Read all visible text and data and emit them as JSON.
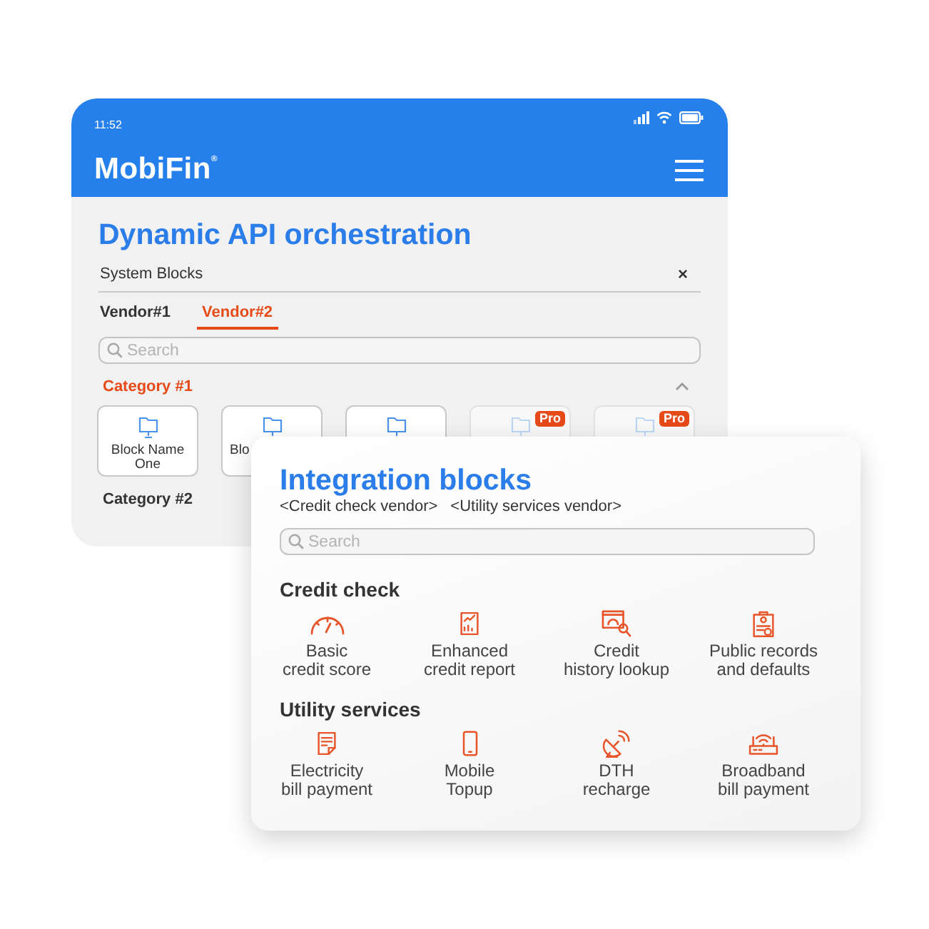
{
  "status_bar": {
    "time": "11:52"
  },
  "app_bar": {
    "logo": "MobiFin$^{®}$"
  },
  "screen": {
    "title": "Dynamic API orchestration",
    "panel": {
      "label": "System Blocks",
      "close": "×"
    },
    "tabs": [
      {
        "label": "Vendor#1",
        "selected": false
      },
      {
        "label": "Vendor#2",
        "selected": true
      }
    ],
    "search": {
      "placeholder": "Search"
    },
    "categories": [
      {
        "title": "Category #1",
        "expanded": true,
        "blocks": [
          {
            "label": "Block Name One",
            "disabled": false
          },
          {
            "label": "Blo",
            "disabled": false
          },
          {
            "disabled": false
          },
          {
            "badge": "Pro",
            "disabled": true
          },
          {
            "badge": "Pro",
            "disabled": true
          }
        ]
      },
      {
        "title": "Category #2",
        "expanded": false
      }
    ]
  },
  "integration_card": {
    "title": "Integration blocks",
    "vendors": [
      "<Credit check vendor>",
      "<Utility services vendor>"
    ],
    "search": {
      "placeholder": "Search"
    },
    "sections": [
      {
        "title": "Credit check",
        "items": [
          {
            "label": "Basic\ncredit score"
          },
          {
            "label": "Enhanced\ncredit report"
          },
          {
            "label": "Credit\nhistory lookup"
          },
          {
            "label": "Public records\nand defaults"
          }
        ]
      },
      {
        "title": "Utility services",
        "items": [
          {
            "label": "Electricity\nbill payment"
          },
          {
            "label": "Mobile\nTopup"
          },
          {
            "label": "DTH\nrecharge"
          },
          {
            "label": "Broadband\nbill payment"
          }
        ]
      }
    ]
  }
}
